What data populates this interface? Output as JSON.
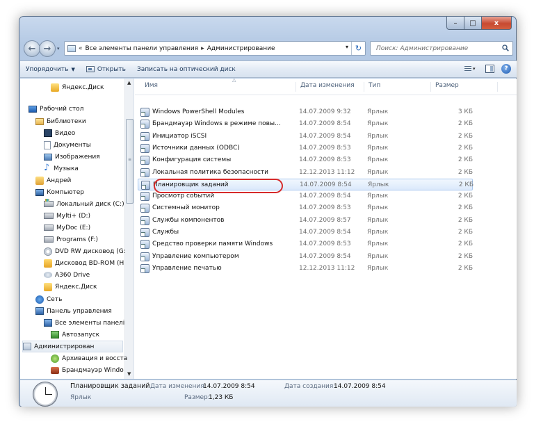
{
  "window": {
    "controls": {
      "minimize": "–",
      "maximize": "□",
      "close": "x"
    }
  },
  "address": {
    "chevron": "«",
    "crumbs": [
      "Все элементы панели управления",
      "Администрирование"
    ],
    "separator": "▸",
    "dropdown": "▾",
    "refresh": "↻"
  },
  "search": {
    "placeholder": "Поиск: Администрирование"
  },
  "toolbar": {
    "organize": "Упорядочить",
    "open": "Открыть",
    "burn": "Записать на оптический диск",
    "view_caret": "▾",
    "help": "?"
  },
  "nav": {
    "items": [
      {
        "label": "Яндекс.Диск",
        "icon": "yadisk"
      },
      {
        "label": "Рабочий стол",
        "icon": "desktop"
      },
      {
        "label": "Библиотеки",
        "icon": "libs"
      },
      {
        "label": "Видео",
        "icon": "video"
      },
      {
        "label": "Документы",
        "icon": "docs"
      },
      {
        "label": "Изображения",
        "icon": "images"
      },
      {
        "label": "Музыка",
        "icon": "music"
      },
      {
        "label": "Андрей",
        "icon": "user"
      },
      {
        "label": "Компьютер",
        "icon": "computer"
      },
      {
        "label": "Локальный диск (C:)",
        "icon": "hdd sys"
      },
      {
        "label": "Mylti+ (D:)",
        "icon": "hdd"
      },
      {
        "label": "MyDoc (E:)",
        "icon": "hdd"
      },
      {
        "label": "Programs (F:)",
        "icon": "hdd"
      },
      {
        "label": "DVD RW дисковод (G:",
        "icon": "dvd"
      },
      {
        "label": "Дисковод BD-ROM (H",
        "icon": "bd"
      },
      {
        "label": "A360 Drive",
        "icon": "cloud"
      },
      {
        "label": "Яндекс.Диск",
        "icon": "yadisk"
      },
      {
        "label": "Сеть",
        "icon": "network"
      },
      {
        "label": "Панель управления",
        "icon": "cpanel"
      },
      {
        "label": "Все элементы панелі",
        "icon": "cpanel"
      },
      {
        "label": "Автозапуск",
        "icon": "autorun"
      },
      {
        "label": "Администрирован",
        "icon": "admin"
      },
      {
        "label": "Архивация и восста",
        "icon": "backup"
      },
      {
        "label": "Брандмауэр Windo",
        "icon": "firewall"
      }
    ]
  },
  "columns": {
    "name": "Имя",
    "date": "Дата изменения",
    "type": "Тип",
    "size": "Размер"
  },
  "files": [
    {
      "name": "Windows PowerShell Modules",
      "date": "14.07.2009 9:32",
      "type": "Ярлык",
      "size": "3 КБ"
    },
    {
      "name": "Брандмауэр Windows в режиме повы...",
      "date": "14.07.2009 8:54",
      "type": "Ярлык",
      "size": "2 КБ"
    },
    {
      "name": "Инициатор iSCSI",
      "date": "14.07.2009 8:54",
      "type": "Ярлык",
      "size": "2 КБ"
    },
    {
      "name": "Источники данных (ODBC)",
      "date": "14.07.2009 8:53",
      "type": "Ярлык",
      "size": "2 КБ"
    },
    {
      "name": "Конфигурация системы",
      "date": "14.07.2009 8:53",
      "type": "Ярлык",
      "size": "2 КБ"
    },
    {
      "name": "Локальная политика безопасности",
      "date": "12.12.2013 11:12",
      "type": "Ярлык",
      "size": "2 КБ"
    },
    {
      "name": "Планировщик заданий",
      "date": "14.07.2009 8:54",
      "type": "Ярлык",
      "size": "2 КБ"
    },
    {
      "name": "Просмотр событий",
      "date": "14.07.2009 8:54",
      "type": "Ярлык",
      "size": "2 КБ"
    },
    {
      "name": "Системный монитор",
      "date": "14.07.2009 8:53",
      "type": "Ярлык",
      "size": "2 КБ"
    },
    {
      "name": "Службы компонентов",
      "date": "14.07.2009 8:57",
      "type": "Ярлык",
      "size": "2 КБ"
    },
    {
      "name": "Службы",
      "date": "14.07.2009 8:54",
      "type": "Ярлык",
      "size": "2 КБ"
    },
    {
      "name": "Средство проверки памяти Windows",
      "date": "14.07.2009 8:53",
      "type": "Ярлык",
      "size": "2 КБ"
    },
    {
      "name": "Управление компьютером",
      "date": "14.07.2009 8:54",
      "type": "Ярлык",
      "size": "2 КБ"
    },
    {
      "name": "Управление печатью",
      "date": "12.12.2013 11:12",
      "type": "Ярлык",
      "size": "2 КБ"
    }
  ],
  "selected_index": 6,
  "details": {
    "title": "Планировщик заданий",
    "kind": "Ярлык",
    "modified_label": "Дата изменения:",
    "modified_value": "14.07.2009 8:54",
    "size_label": "Размер:",
    "size_value": "1,23 КБ",
    "created_label": "Дата создания:",
    "created_value": "14.07.2009 8:54"
  },
  "colors": {
    "highlight": "#d62a2a",
    "selection": "#dbe9fb"
  }
}
